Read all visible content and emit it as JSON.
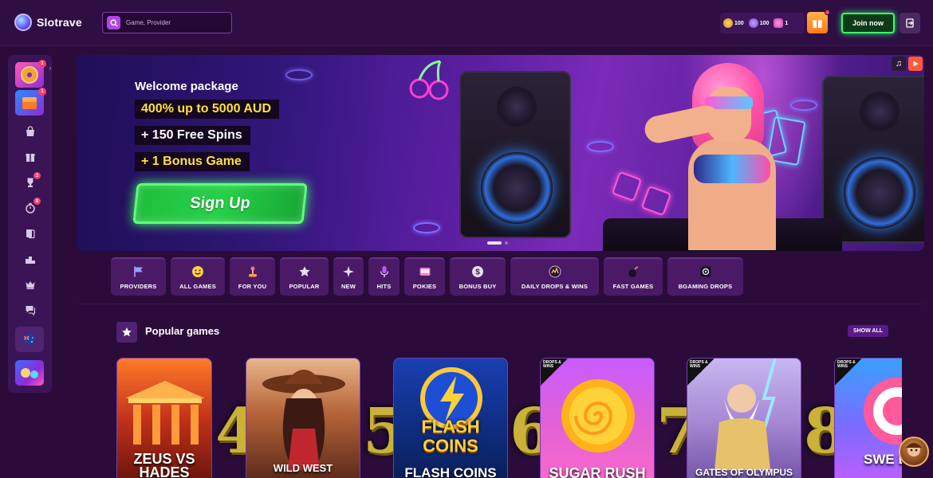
{
  "header": {
    "brand": "Slotrave",
    "search_placeholder": "Game, Provider",
    "wallets": [
      {
        "icon": "gold-coin-icon",
        "value": "100"
      },
      {
        "icon": "purple-coin-icon",
        "value": "100"
      },
      {
        "icon": "bb-coin-icon",
        "value": "1"
      }
    ],
    "join_label": "Join now"
  },
  "sidebar": {
    "badges": {
      "promo1": "1",
      "promo2": "1",
      "trophy": "2",
      "timer": "8"
    }
  },
  "banner": {
    "welcome": "Welcome package",
    "line1": "400% up to 5000 AUD",
    "line2": "+ 150 Free Spins",
    "line3": "+ 1 Bonus Game",
    "signup_label": "Sign Up"
  },
  "categories": [
    {
      "label": "PROVIDERS",
      "icon": "flag-icon"
    },
    {
      "label": "ALL GAMES",
      "icon": "smiley-icon"
    },
    {
      "label": "FOR YOU",
      "icon": "joystick-icon"
    },
    {
      "label": "POPULAR",
      "icon": "star-icon"
    },
    {
      "label": "NEW",
      "icon": "sparkle-icon"
    },
    {
      "label": "HITS",
      "icon": "mic-icon"
    },
    {
      "label": "POKIES",
      "icon": "slot-icon"
    },
    {
      "label": "BONUS BUY",
      "icon": "dollar-icon"
    },
    {
      "label": "DAILY DROPS & WINS",
      "icon": "drops-icon"
    },
    {
      "label": "FAST GAMES",
      "icon": "bomb-icon"
    },
    {
      "label": "BGAMING DROPS",
      "icon": "bgaming-icon"
    }
  ],
  "popular": {
    "title": "Popular games",
    "show_all": "SHOW ALL",
    "games": [
      {
        "title": "ZEUS VS HADES",
        "rank": ""
      },
      {
        "title": "WILD WEST",
        "rank": "4"
      },
      {
        "title": "FLASH COINS",
        "rank": "5"
      },
      {
        "title": "SUGAR RUSH",
        "rank": "6"
      },
      {
        "title": "GATES OF OLYMPUS",
        "rank": "7"
      },
      {
        "title": "SWE BONAN",
        "rank": "8"
      }
    ],
    "drops_badge": "DROPS & WINS"
  },
  "colors": {
    "page_bg": "#2a0b3a",
    "accent_green": "#39ff6e",
    "promo_yellow": "#ffe23a",
    "badge_red": "#ff3b6b"
  }
}
